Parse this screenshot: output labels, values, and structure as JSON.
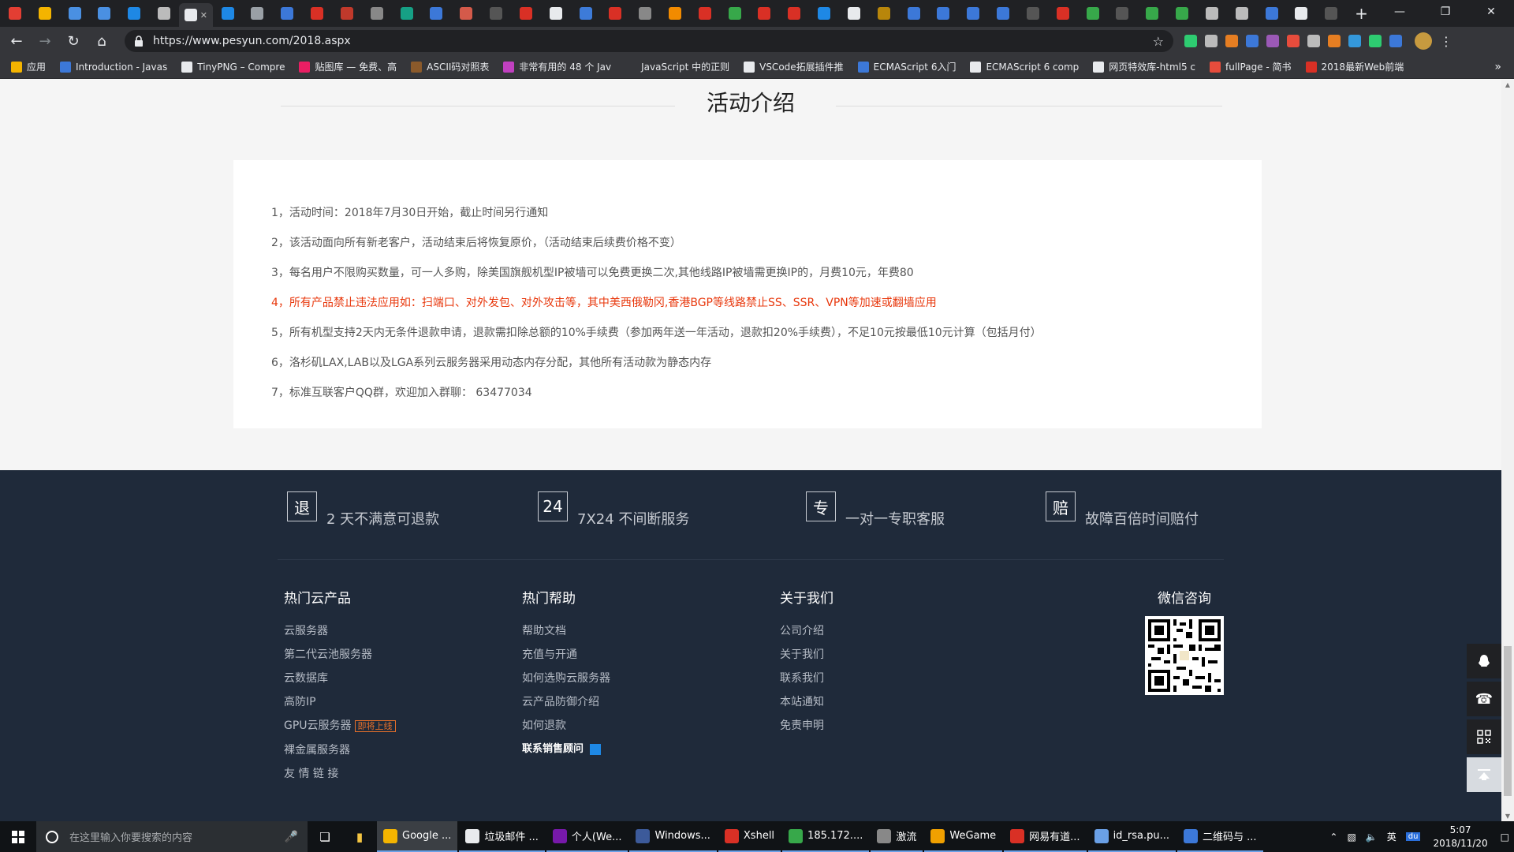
{
  "browser": {
    "tab_icon_colors": [
      "#e33e33",
      "#f4b400",
      "#4a90e2",
      "#4a90e2",
      "#1e88e5",
      "#bbbbbb",
      "#e8eaed",
      "#1e88e5",
      "#9aa0a6",
      "#3c78d8",
      "#d93025",
      "#c0392b",
      "#888888",
      "#16a085",
      "#3c78d8",
      "#d45a4a",
      "#555555",
      "#d93025",
      "#e8eaed",
      "#3d7bd9",
      "#d93025",
      "#888888",
      "#f28b00",
      "#d93025",
      "#37a84a",
      "#d93025",
      "#d93025",
      "#1e88e5",
      "#e8eaed",
      "#b8860b",
      "#3c78d8",
      "#3c78d8",
      "#3c78d8",
      "#3c78d8",
      "#555555",
      "#d93025",
      "#37a84a",
      "#555555",
      "#37a84a",
      "#37a84a",
      "#bbbbbb",
      "#bbbbbb",
      "#3c78d8",
      "#e8eaed",
      "#555555"
    ],
    "new_tab_label": "+",
    "window_controls": [
      "—",
      "❐",
      "✕"
    ],
    "url": "https://www.pesyun.com/2018.aspx",
    "star_icon": "☆",
    "ext_colors": [
      "#2ecc71",
      "#bbbbbb",
      "#e67e22",
      "#3c78d8",
      "#9b59b6",
      "#e74c3c",
      "#bbbbbb",
      "#e67e22",
      "#3498db",
      "#2ecc71",
      "#3c78d8"
    ],
    "bookmarks": [
      {
        "label": "应用",
        "color": "#f4b400"
      },
      {
        "label": "Introduction - Javas",
        "color": "#3c78d8"
      },
      {
        "label": "TinyPNG – Compre",
        "color": "#e8eaed"
      },
      {
        "label": "贴图库 — 免费、高",
        "color": "#e91e63"
      },
      {
        "label": "ASCII码对照表",
        "color": "#8b5a2b"
      },
      {
        "label": "非常有用的 48 个 Jav",
        "color": "#c040c0"
      },
      {
        "label": "JavaScript 中的正则",
        "color": "#35363a"
      },
      {
        "label": "VSCode拓展插件推",
        "color": "#e8eaed"
      },
      {
        "label": "ECMAScript 6入门",
        "color": "#3c78d8"
      },
      {
        "label": "ECMAScript 6 comp",
        "color": "#e8eaed"
      },
      {
        "label": "网页特效库-html5 c",
        "color": "#e8eaed"
      },
      {
        "label": "fullPage - 简书",
        "color": "#e74c3c"
      },
      {
        "label": "2018最新Web前端",
        "color": "#d93025"
      }
    ],
    "bookmarks_more": "»"
  },
  "page": {
    "section_title": "活动介绍",
    "notices": [
      {
        "text": "1，活动时间：2018年7月30日开始，截止时间另行通知",
        "warn": false
      },
      {
        "text": "2，该活动面向所有新老客户，活动结束后将恢复原价，（活动结束后续费价格不变）",
        "warn": false
      },
      {
        "text": "3，每名用户不限购买数量，可一人多购，除美国旗舰机型IP被墙可以免费更换二次,其他线路IP被墙需更换IP的，月费10元，年费80",
        "warn": false
      },
      {
        "text": "4，所有产品禁止违法应用如：扫端口、对外发包、对外攻击等，其中美西俄勒冈,香港BGP等线路禁止SS、SSR、VPN等加速或翻墙应用",
        "warn": true
      },
      {
        "text": "5，所有机型支持2天内无条件退款申请，退款需扣除总额的10%手续费（参加两年送一年活动，退款扣20%手续费），不足10元按最低10元计算（包括月付）",
        "warn": false
      },
      {
        "text": "6，洛杉矶LAX,LAB以及LGA系列云服务器采用动态内存分配，其他所有活动款为静态内存",
        "warn": false
      },
      {
        "text": "7，标准互联客户QQ群，欢迎加入群聊： 63477034",
        "warn": false
      }
    ]
  },
  "footer": {
    "promises": [
      {
        "box": "退",
        "text": "2 天不满意可退款"
      },
      {
        "box": "24",
        "text": "7X24 不间断服务"
      },
      {
        "box": "专",
        "text": "一对一专职客服"
      },
      {
        "box": "赔",
        "text": "故障百倍时间赔付"
      }
    ],
    "col_products": {
      "title": "热门云产品",
      "links": [
        "云服务器",
        "第二代云池服务器",
        "云数据库",
        "高防IP",
        "GPU云服务器",
        "裸金属服务器",
        "友 情 链 接"
      ],
      "badge": "即将上线"
    },
    "col_help": {
      "title": "热门帮助",
      "links": [
        "帮助文档",
        "充值与开通",
        "如何选购云服务器",
        "云产品防御介绍",
        "如何退款"
      ],
      "sales": "联系销售顾问"
    },
    "col_about": {
      "title": "关于我们",
      "links": [
        "公司介绍",
        "关于我们",
        "联系我们",
        "本站通知",
        "免责申明"
      ]
    },
    "wechat_title": "微信咨询"
  },
  "float_bar": {
    "icons": [
      "qq-icon",
      "phone-icon",
      "qrcode-icon",
      "back-to-top-icon"
    ]
  },
  "taskbar": {
    "search_placeholder": "在这里输入你要搜索的内容",
    "apps": [
      {
        "label": "Google ...",
        "color": "#f4b400",
        "active": true
      },
      {
        "label": "垃圾邮件 ...",
        "color": "#e8eaed",
        "active": false
      },
      {
        "label": "个人(We...",
        "color": "#7719aa",
        "active": false
      },
      {
        "label": "Windows...",
        "color": "#3c5a9a",
        "active": false
      },
      {
        "label": "Xshell",
        "color": "#d93025",
        "active": false
      },
      {
        "label": "185.172....",
        "color": "#37a84a",
        "active": false
      },
      {
        "label": "激流",
        "color": "#888888",
        "active": false
      },
      {
        "label": "WeGame",
        "color": "#f0a000",
        "active": false
      },
      {
        "label": "网易有道...",
        "color": "#d93025",
        "active": false
      },
      {
        "label": "id_rsa.pu...",
        "color": "#6aa0e6",
        "active": false
      },
      {
        "label": "二维码与 ...",
        "color": "#3c78d8",
        "active": false
      }
    ],
    "tray_lang": "英",
    "time": "5:07",
    "date": "2018/11/20"
  }
}
